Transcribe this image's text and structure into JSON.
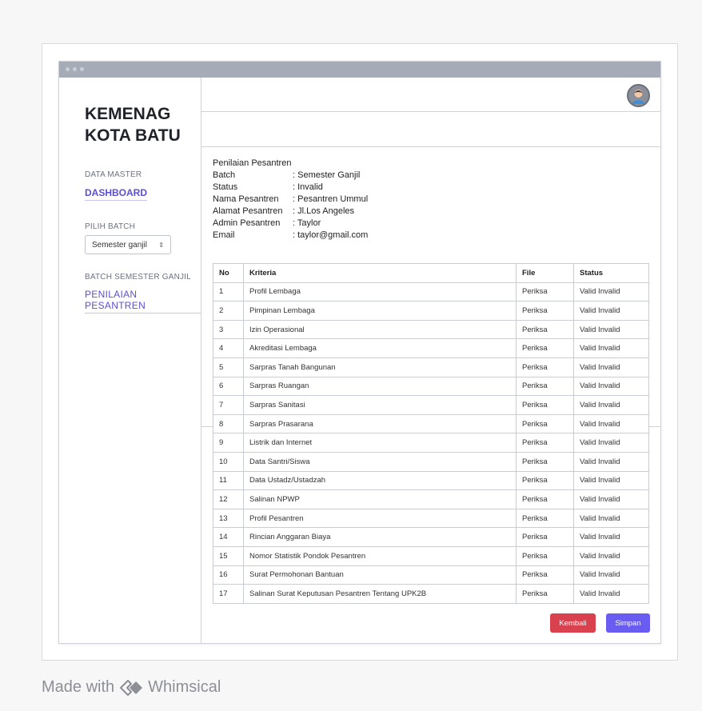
{
  "brand": {
    "line1": "KEMENAG",
    "line2": "KOTA BATU"
  },
  "sidebar": {
    "data_master_label": "DATA MASTER",
    "dashboard_link": "DASHBOARD",
    "pilih_batch_label": "PILIH BATCH",
    "batch_select_value": "Semester ganjil",
    "batch_semester_label": "BATCH SEMESTER GANJIL",
    "penilaian_link": "PENILAIAN PESANTREN"
  },
  "info": {
    "title": "Penilaian Pesantren",
    "rows": [
      {
        "key": "Batch",
        "value": ": Semester Ganjil"
      },
      {
        "key": "Status",
        "value": ": Invalid"
      },
      {
        "key": "Nama Pesantren",
        "value": ": Pesantren Ummul"
      },
      {
        "key": "Alamat Pesantren",
        "value": ": Jl.Los Angeles"
      },
      {
        "key": "Admin Pesantren",
        "value": ": Taylor"
      },
      {
        "key": "Email",
        "value": ": taylor@gmail.com"
      }
    ]
  },
  "table": {
    "headers": [
      "No",
      "Kriteria",
      "File",
      "Status"
    ],
    "rows": [
      [
        "1",
        "Profil Lembaga",
        "Periksa",
        "Valid Invalid"
      ],
      [
        "2",
        "Pimpinan Lembaga",
        "Periksa",
        "Valid Invalid"
      ],
      [
        "3",
        "Izin Operasional",
        "Periksa",
        "Valid Invalid"
      ],
      [
        "4",
        "Akreditasi Lembaga",
        "Periksa",
        "Valid Invalid"
      ],
      [
        "5",
        "Sarpras Tanah Bangunan",
        "Periksa",
        "Valid Invalid"
      ],
      [
        "6",
        "Sarpras Ruangan",
        "Periksa",
        "Valid Invalid"
      ],
      [
        "7",
        "Sarpras Sanitasi",
        "Periksa",
        "Valid Invalid"
      ],
      [
        "8",
        "Sarpras Prasarana",
        "Periksa",
        "Valid Invalid"
      ],
      [
        "9",
        "Listrik dan Internet",
        "Periksa",
        "Valid Invalid"
      ],
      [
        "10",
        "Data Santri/Siswa",
        "Periksa",
        "Valid Invalid"
      ],
      [
        "11",
        "Data Ustadz/Ustadzah",
        "Periksa",
        "Valid Invalid"
      ],
      [
        "12",
        "Salinan NPWP",
        "Periksa",
        "Valid Invalid"
      ],
      [
        "13",
        "Profil Pesantren",
        "Periksa",
        "Valid Invalid"
      ],
      [
        "14",
        "Rincian Anggaran Biaya",
        "Periksa",
        "Valid Invalid"
      ],
      [
        "15",
        "Nomor Statistik Pondok Pesantren",
        "Periksa",
        "Valid Invalid"
      ],
      [
        "16",
        "Surat Permohonan Bantuan",
        "Periksa",
        "Valid Invalid"
      ],
      [
        "17",
        "Salinan Surat Keputusan Pesantren Tentang UPK2B",
        "Periksa",
        "Valid Invalid"
      ]
    ]
  },
  "buttons": {
    "back": "Kembali",
    "save": "Simpan"
  },
  "footer": {
    "made_with": "Made with",
    "brand": "Whimsical"
  },
  "icons": {
    "avatar": "user-avatar-icon",
    "select": "chevron-updown-icon",
    "logo": "whimsical-logo-icon"
  },
  "colors": {
    "accent": "#5b4fd6",
    "danger": "#d9414f",
    "primary": "#6a5cf0"
  }
}
